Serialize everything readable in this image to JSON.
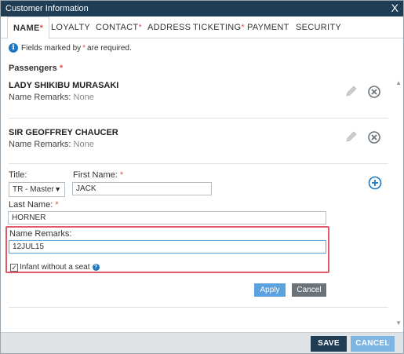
{
  "window": {
    "title": "Customer Information",
    "close_symbol": "X"
  },
  "tabs": [
    {
      "label": "NAME",
      "required": "*"
    },
    {
      "label": "LOYALTY",
      "required": ""
    },
    {
      "label": "CONTACT",
      "required": "*"
    },
    {
      "label": "ADDRESS",
      "required": ""
    },
    {
      "label": "TICKETING",
      "required": "*"
    },
    {
      "label": "PAYMENT",
      "required": ""
    },
    {
      "label": "SECURITY",
      "required": ""
    }
  ],
  "info": {
    "before": "Fields marked by ",
    "star": "*",
    "after": " are required.",
    "icon": "info-icon"
  },
  "passengers_section": {
    "label": "Passengers",
    "required": "*"
  },
  "passengers": [
    {
      "name": "LADY SHIKIBU MURASAKI",
      "remarks_label": "Name Remarks:",
      "remarks_value": "None"
    },
    {
      "name": "SIR GEOFFREY CHAUCER",
      "remarks_label": "Name Remarks:",
      "remarks_value": "None"
    }
  ],
  "form": {
    "title_label": "Title:",
    "title_value": "TR - Master",
    "first_name_label": "First Name:",
    "first_name_required": "*",
    "first_name_value": "JACK",
    "last_name_label": "Last Name:",
    "last_name_required": "*",
    "last_name_value": "HORNER",
    "name_remarks_label": "Name Remarks:",
    "name_remarks_value": "12JUL15",
    "infant_label": "Infant without a seat",
    "infant_checked": true,
    "apply_label": "Apply",
    "cancel_label": "Cancel"
  },
  "footer": {
    "save_label": "SAVE",
    "cancel_label": "CANCEL"
  },
  "colors": {
    "titlebar": "#1f3d55",
    "accent": "#1d78c1",
    "highlight": "#e05a6a",
    "required": "#d9534f"
  }
}
